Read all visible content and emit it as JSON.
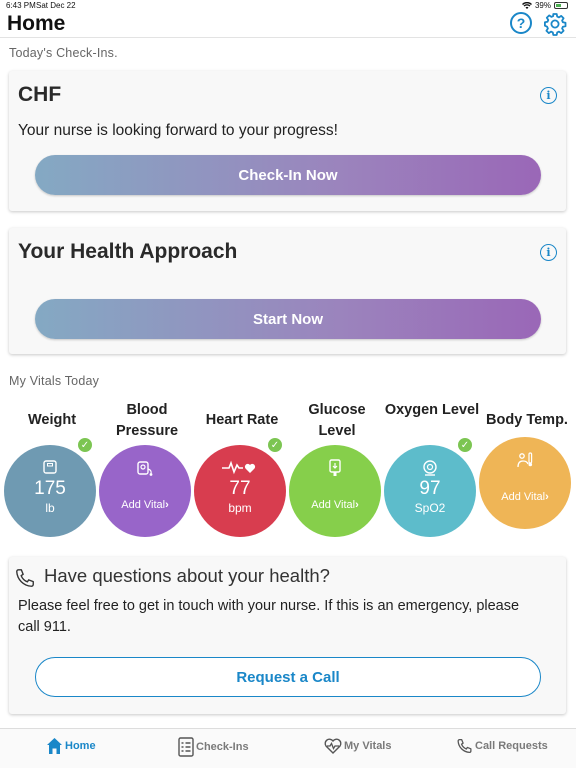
{
  "status": {
    "time": "6:43 PM",
    "date": "Sat Dec 22",
    "battery": "39%"
  },
  "header": {
    "title": "Home",
    "help_icon": "question-circle-icon",
    "settings_icon": "gear-icon"
  },
  "checkins": {
    "section_label": "Today's Check-Ins.",
    "cards": [
      {
        "title": "CHF",
        "text": "Your nurse is looking forward to your progress!",
        "button": "Check-In Now"
      },
      {
        "title": "Your Health Approach",
        "text": "",
        "button": "Start Now"
      }
    ],
    "info_glyph": "i"
  },
  "vitals": {
    "section_label": "My Vitals Today",
    "items": [
      {
        "label": "Weight",
        "value": "175",
        "unit": "lb",
        "add": "",
        "color": "#6f9ab2",
        "checked": true,
        "icon": "scale-icon"
      },
      {
        "label": "Blood Pressure",
        "value": "",
        "unit": "",
        "add": "Add Vital",
        "color": "#9865c9",
        "checked": false,
        "icon": "blood-pressure-icon"
      },
      {
        "label": "Heart Rate",
        "value": "77",
        "unit": "bpm",
        "add": "",
        "color": "#d83d4f",
        "checked": true,
        "icon": "heartbeat-icon"
      },
      {
        "label": "Glucose Level",
        "value": "",
        "unit": "",
        "add": "Add Vital",
        "color": "#86cf4b",
        "checked": false,
        "icon": "glucose-meter-icon"
      },
      {
        "label": "Oxygen Level",
        "value": "97",
        "unit": "SpO2",
        "add": "",
        "color": "#5dbccb",
        "checked": true,
        "icon": "oximeter-icon"
      },
      {
        "label": "Body Temp.",
        "value": "",
        "unit": "",
        "add": "Add Vital",
        "color": "#efb556",
        "checked": false,
        "icon": "thermometer-icon"
      }
    ],
    "check_glyph": "✓",
    "add_arrow": "›"
  },
  "questions": {
    "title": "Have questions about your health?",
    "text_line1": "Please feel free to get in touch with your nurse. If this is an emergency, please",
    "text_line2": "call 911.",
    "button": "Request a Call",
    "icon": "phone-icon"
  },
  "tabs": [
    {
      "label": "Home",
      "icon": "home-icon",
      "active": true
    },
    {
      "label": "Check-Ins",
      "icon": "checklist-icon",
      "active": false
    },
    {
      "label": "My Vitals",
      "icon": "vitals-icon",
      "active": false
    },
    {
      "label": "Call Requests",
      "icon": "phone-icon",
      "active": false
    }
  ],
  "colors": {
    "accent": "#1a87c8",
    "gradient_start": "#84a9c3",
    "gradient_end": "#9a67b7",
    "check_green": "#7cc552"
  }
}
